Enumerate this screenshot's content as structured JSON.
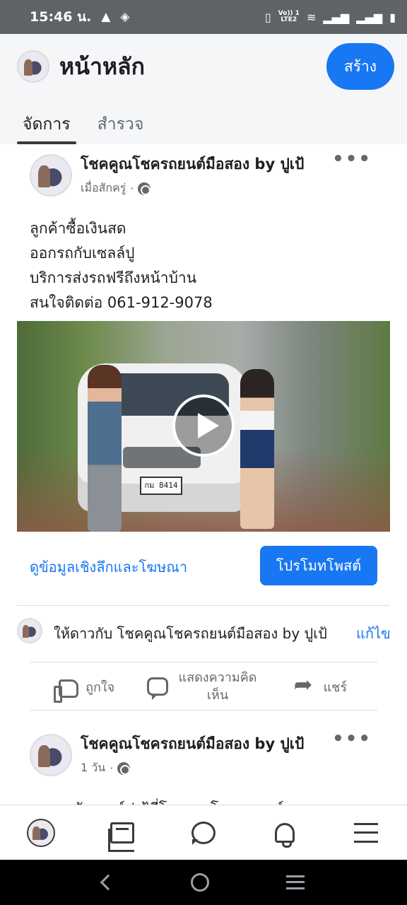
{
  "status_bar": {
    "time": "15:46 น.",
    "network_label_top": "Vo)) 1",
    "network_label_bottom": "LTE2"
  },
  "header": {
    "title": "หน้าหลัก",
    "create_label": "สร้าง"
  },
  "tabs": [
    {
      "label": "จัดการ",
      "active": true
    },
    {
      "label": "สำรวจ",
      "active": false
    }
  ],
  "post1": {
    "page_name": "โชคคูณโชครถยนต์มือสอง by ปูเป้",
    "time": "เมื่อสักครู่",
    "meta_sep": "·",
    "lines": [
      "ลูกค้าซื้อเงินสด",
      "ออกรถกับเซลล์ปู",
      "บริการส่งรถฟรีถึงหน้าบ้าน",
      "สนใจติดต่อ 061-912-9078"
    ],
    "video_plate": "กม 8414",
    "insights_label": "ดูข้อมูลเชิงลึกและโฆษณา",
    "promote_label": "โปรโมทโพสต์"
  },
  "rating": {
    "text": "ให้ดาวกับ โชคคูณโชครถยนต์มือสอง by ปูเป้",
    "edit_label": "แก้ไข"
  },
  "actions": {
    "like_label": "ถูกใจ",
    "comment_label_line1": "แสดงความคิด",
    "comment_label_line2": "เห็น",
    "share_label": "แชร์"
  },
  "post2": {
    "page_name": "โชคคูณโชครถยนต์มือสอง by ปูเป้",
    "time": "1 วัน",
    "meta_sep": "·",
    "text_partial": "ออกรถกับเซลล์ปูเป้ที่โชคคูณโชครถยนต์"
  },
  "colors": {
    "accent": "#1877f2",
    "status_bar": "#5f6368",
    "header_bg": "#f5f6f7"
  },
  "icons": {
    "bottom_nav": [
      "profile-avatar",
      "pages-icon",
      "chat-icon",
      "bell-icon",
      "menu-icon"
    ],
    "system_nav": [
      "back-icon",
      "home-icon",
      "recents-icon"
    ]
  }
}
